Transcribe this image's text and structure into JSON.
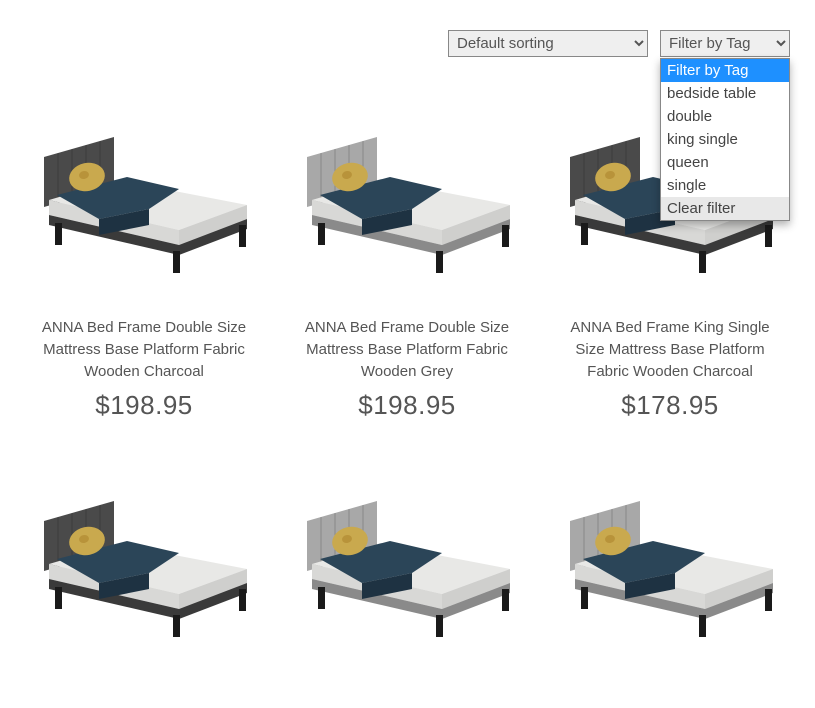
{
  "sort": {
    "selected": "Default sorting"
  },
  "tag_filter": {
    "selected": "Filter by Tag",
    "options": [
      {
        "label": "Filter by Tag",
        "selected": true,
        "highlight": false
      },
      {
        "label": "bedside table",
        "selected": false,
        "highlight": false
      },
      {
        "label": "double",
        "selected": false,
        "highlight": false
      },
      {
        "label": "king single",
        "selected": false,
        "highlight": false
      },
      {
        "label": "queen",
        "selected": false,
        "highlight": false
      },
      {
        "label": "single",
        "selected": false,
        "highlight": false
      },
      {
        "label": "Clear filter",
        "selected": false,
        "highlight": true
      }
    ]
  },
  "products": [
    {
      "title": "ANNA Bed Frame Double Size Mattress Base Platform Fabric Wooden Charcoal",
      "price": "$198.95",
      "variant": "charcoal"
    },
    {
      "title": "ANNA Bed Frame Double Size Mattress Base Platform Fabric Wooden Grey",
      "price": "$198.95",
      "variant": "grey"
    },
    {
      "title": "ANNA Bed Frame King Single Size Mattress Base Platform Fabric Wooden Charcoal",
      "price": "$178.95",
      "variant": "charcoal"
    },
    {
      "title": "",
      "price": "",
      "variant": "charcoal"
    },
    {
      "title": "",
      "price": "",
      "variant": "grey"
    },
    {
      "title": "",
      "price": "",
      "variant": "grey"
    }
  ],
  "colors": {
    "charcoal_head": "#4a4a4a",
    "charcoal_base": "#3a3a3a",
    "grey_head": "#a8a8a8",
    "grey_base": "#8a8a8a",
    "mattress": "#e8e8e6",
    "blanket": "#2b4558",
    "pillow": "#c9a94e"
  }
}
